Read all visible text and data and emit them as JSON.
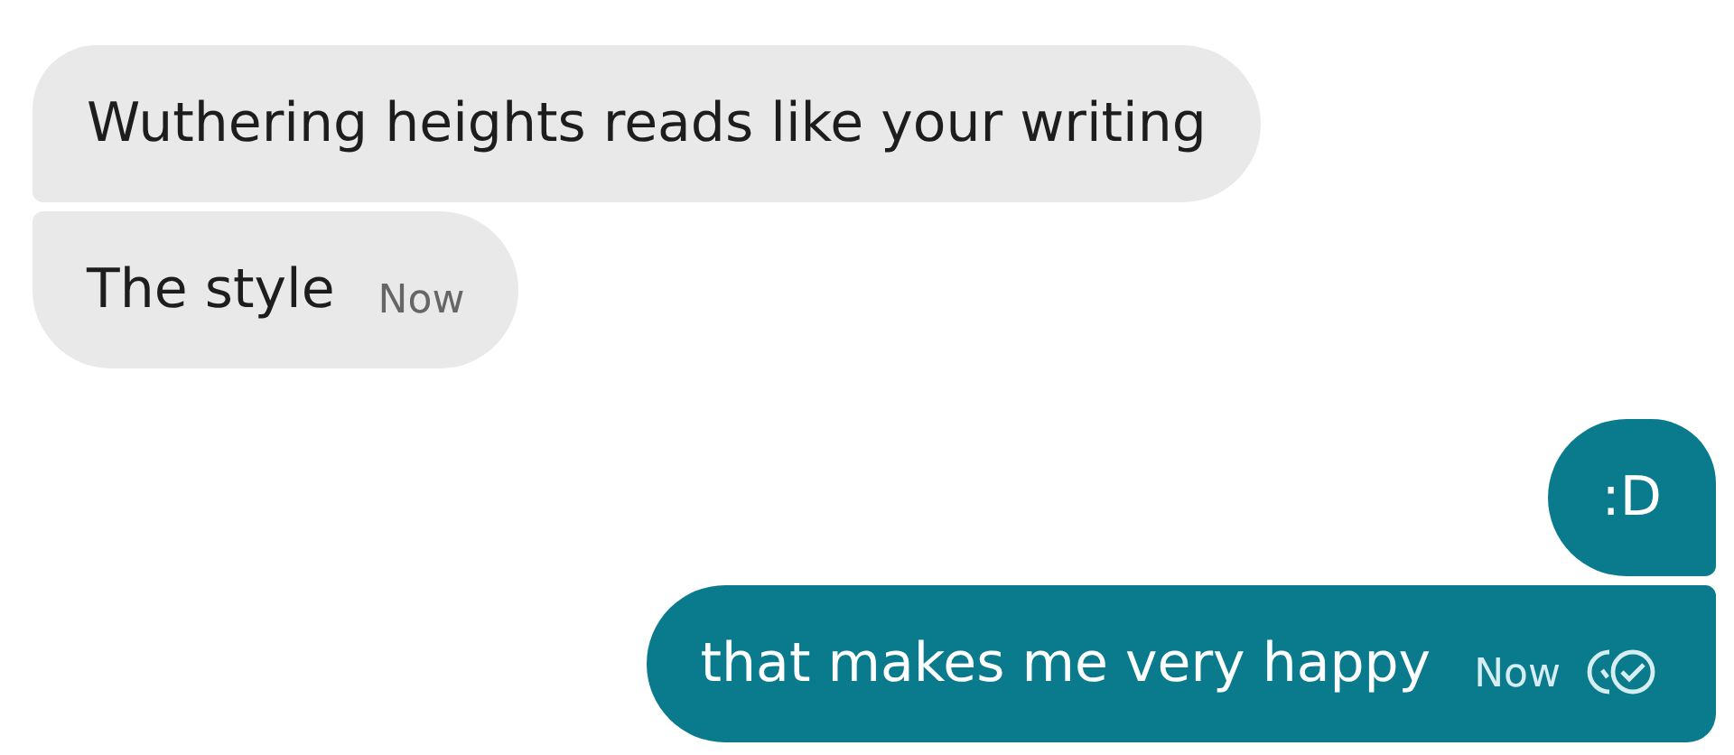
{
  "messages": [
    {
      "kind": "received",
      "text": "Wuthering heights reads like your writing"
    },
    {
      "kind": "received",
      "text": "The style",
      "time": "Now"
    },
    {
      "kind": "sent",
      "text": ":D"
    },
    {
      "kind": "sent",
      "text": "that makes me very happy",
      "time": "Now",
      "read": true
    }
  ]
}
